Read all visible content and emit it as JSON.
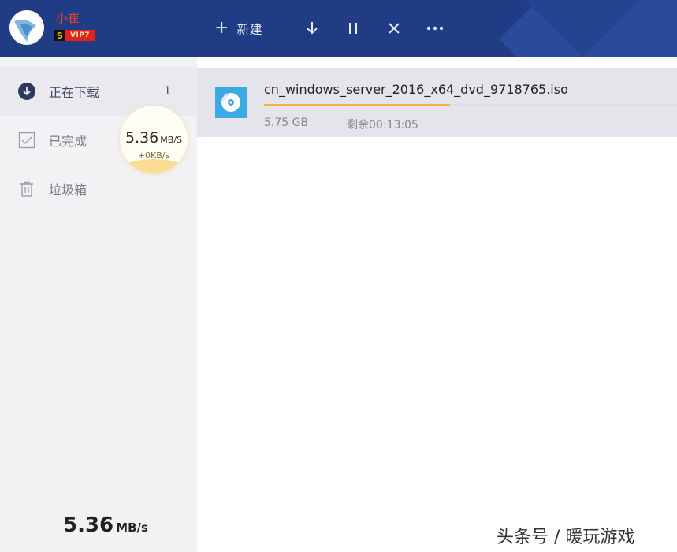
{
  "user": {
    "name": "小崔",
    "vip_s": "S",
    "vip_label": "VIP7"
  },
  "toolbar": {
    "new_label": "新建",
    "icons": [
      "plus-icon",
      "download-arrow-icon",
      "pause-icon",
      "close-icon",
      "more-icon"
    ]
  },
  "sidebar": {
    "items": [
      {
        "label": "正在下载",
        "count": "1",
        "icon": "download-circle-icon"
      },
      {
        "label": "已完成",
        "count": "",
        "icon": "check-square-icon"
      },
      {
        "label": "垃圾箱",
        "count": "",
        "icon": "trash-icon"
      }
    ],
    "speed_bubble": {
      "value": "5.36",
      "unit": "MB/S",
      "sub": "+0KB/s"
    },
    "total_speed": {
      "value": "5.36",
      "unit": "MB/s"
    }
  },
  "task": {
    "file_name": "cn_windows_server_2016_x64_dvd_9718765.iso",
    "size": "5.75 GB",
    "remaining": "剩余00:13:05",
    "progress_percent": 45,
    "icon": "disc-icon"
  },
  "watermark": "头条号 / 暖玩游戏",
  "colors": {
    "topbar": "#1f3c84",
    "progress": "#f1b43e",
    "accent_red": "#e8432a"
  }
}
